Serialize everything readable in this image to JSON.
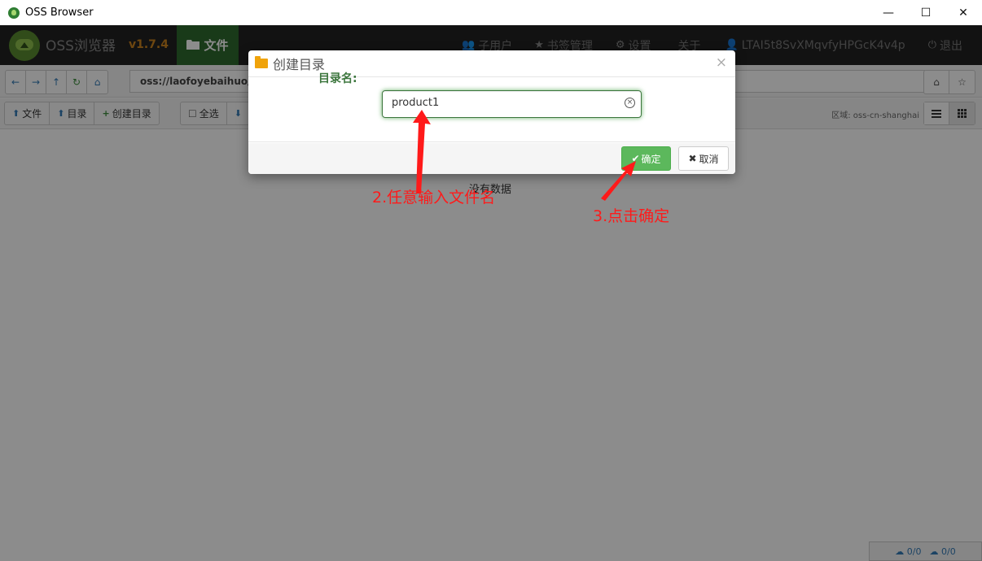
{
  "window": {
    "title": "OSS Browser",
    "minimize": "—",
    "maximize": "☐",
    "close": "✕"
  },
  "navbar": {
    "brand": "OSS浏览器",
    "version": "v1.7.4",
    "files_tab": "文件",
    "items": [
      {
        "icon": "users-icon",
        "glyph": "👥",
        "label": "子用户"
      },
      {
        "icon": "star-icon",
        "glyph": "★",
        "label": "书签管理"
      },
      {
        "icon": "gear-icon",
        "glyph": "⚙",
        "label": "设置"
      },
      {
        "icon": "",
        "glyph": "",
        "label": "关于"
      },
      {
        "icon": "user-icon",
        "glyph": "👤",
        "label": "LTAI5t8SvXMqvfyHPGcK4v4p"
      },
      {
        "icon": "power-icon",
        "glyph": "⏻",
        "label": "退出"
      }
    ]
  },
  "address": {
    "value": "oss://laofoyebaihuo/"
  },
  "toolbar": {
    "upload_file": "文件",
    "upload_dir": "目录",
    "create_dir": "创建目录",
    "select_all": "全选",
    "region": "区域: oss-cn-shanghai"
  },
  "content": {
    "empty": "没有数据"
  },
  "status": {
    "upload": "0/0",
    "download": "0/0"
  },
  "modal": {
    "title": "创建目录",
    "field_label": "目录名:",
    "input_value": "product1",
    "ok": "确定",
    "cancel": "取消"
  },
  "annotations": {
    "step2": "2.任意输入文件名",
    "step3": "3.点击确定"
  },
  "colors": {
    "accent_green": "#5cb85c",
    "nav_bg": "#222222",
    "annotation": "#ff1a1a",
    "version": "#c8821e"
  }
}
